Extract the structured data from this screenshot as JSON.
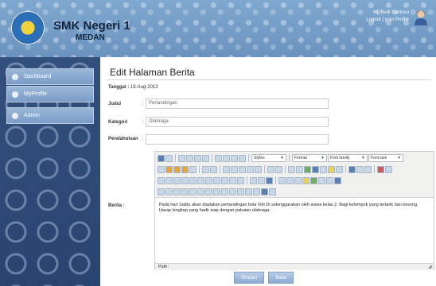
{
  "header": {
    "school_name": "SMK Negeri 1",
    "school_city": "MEDAN",
    "user_name": "Hi, Budi Santoso",
    "user_role": "Logout | your Profile",
    "colors": {
      "header_bg": "#6b93bf",
      "title_text": "#10243d"
    }
  },
  "sidebar": {
    "items": [
      {
        "label": "Dashboard",
        "icon": "circle-bullet-icon"
      },
      {
        "label": "MyProfile",
        "icon": "circle-bullet-icon"
      },
      {
        "label": "Admin",
        "icon": "circle-bullet-icon"
      }
    ]
  },
  "main": {
    "title": "Edit Halaman Berita",
    "date_label": "Tanggal :",
    "date_value": "19-Aug-2013",
    "fields": {
      "judul": {
        "label": "Judul",
        "value": "Pertandingan"
      },
      "kategori": {
        "label": "Kategori",
        "value": "Olahraga"
      },
      "pendahuluan": {
        "label": "Pendahuluan",
        "value": ""
      },
      "berita": {
        "label": "Berita :"
      }
    },
    "editor": {
      "style_select": "Styles",
      "format_select": "Format",
      "font_family_select": "Font family",
      "font_size_select": "Font size",
      "content": "Pada hari Sabtu akan diadakan pertandingan bola Voli Di selenggarakan oleh siswa kelas 2. Bagi kelompok yang tertarik dan kosong. Harap lengkap yang hadir siap dengan pakaian olahraga.",
      "status_path": "Path:"
    },
    "buttons": {
      "submit": "Simpan",
      "cancel": "Batal"
    }
  }
}
